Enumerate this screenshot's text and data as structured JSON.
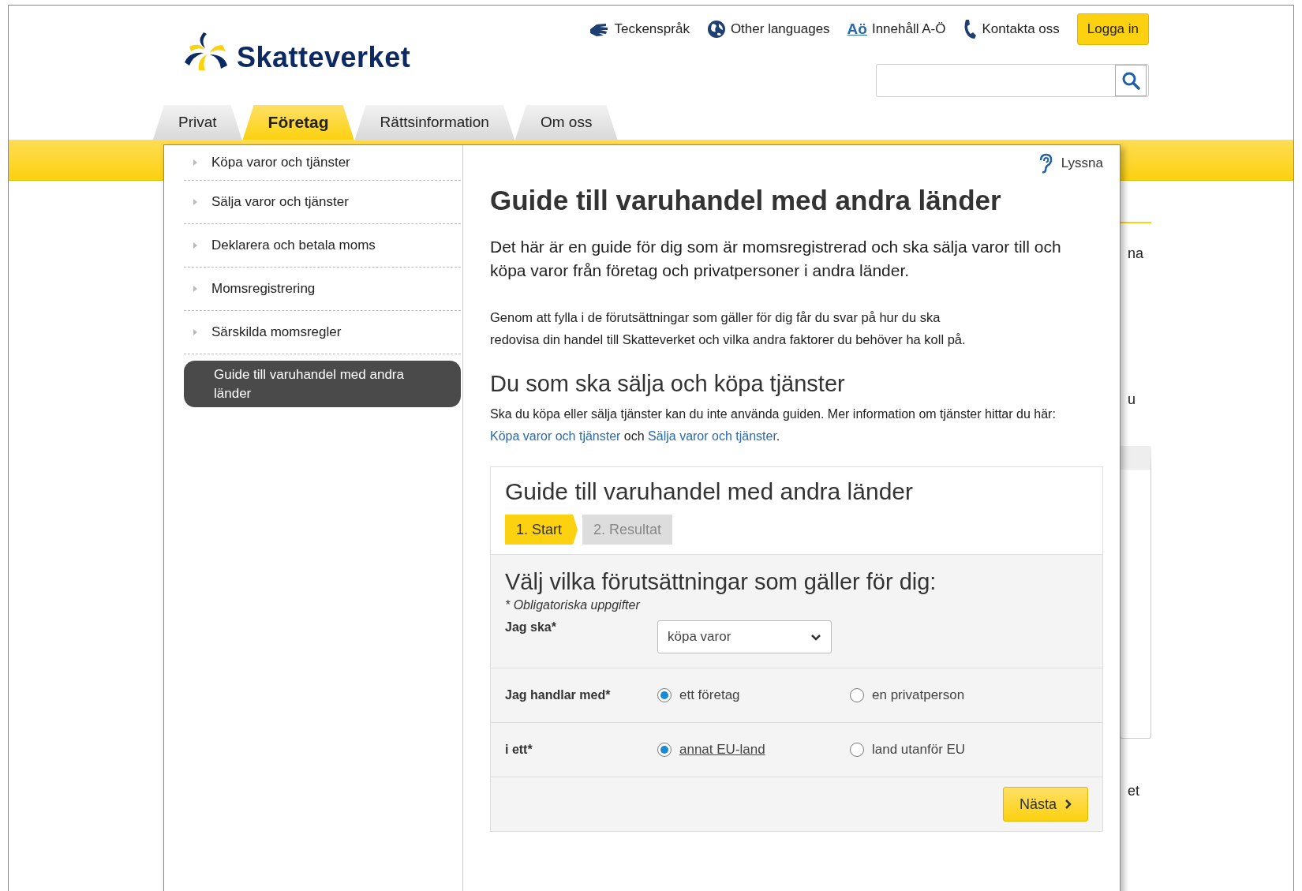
{
  "header": {
    "logo": "Skatteverket",
    "links": [
      {
        "kind": "sign",
        "label": "Teckenspråk"
      },
      {
        "kind": "globe",
        "label": "Other languages"
      },
      {
        "kind": "az",
        "icon_text": "Aö",
        "label": "Innehåll A-Ö"
      },
      {
        "kind": "phone",
        "label": "Kontakta oss"
      }
    ],
    "login": "Logga in"
  },
  "tabs": [
    {
      "label": "Privat",
      "selected": false
    },
    {
      "label": "Företag",
      "selected": true
    },
    {
      "label": "Rättsinformation",
      "selected": false
    },
    {
      "label": "Om oss",
      "selected": false
    }
  ],
  "background_fragments": [
    "na",
    "u",
    "et"
  ],
  "nav": {
    "items": [
      {
        "label": "Köpa varor och tjänster",
        "selected": false
      },
      {
        "label": "Sälja varor och tjänster",
        "selected": false
      },
      {
        "label": "Deklarera och betala moms",
        "selected": false
      },
      {
        "label": "Momsregistrering",
        "selected": false
      },
      {
        "label": "Särskilda momsregler",
        "selected": false
      },
      {
        "label": "Guide till varuhandel med andra länder",
        "selected": true
      }
    ]
  },
  "article": {
    "listen": "Lyssna",
    "title": "Guide till varuhandel med andra länder",
    "lead": "Det här är en guide för dig som är momsregistrerad och ska sälja varor till och köpa varor från företag och privatpersoner i andra länder.",
    "body": "Genom att fylla i de förutsättningar som gäller för dig får du svar på hur du ska redovisa din handel till Skatteverket och vilka andra faktorer du behöver ha koll på.",
    "subheading": "Du som ska sälja och köpa tjänster",
    "services": {
      "before": "Ska du köpa eller sälja tjänster kan du inte använda guiden. Mer information om tjänster hittar du här: ",
      "link1": "Köpa varor och tjänster",
      "middle": " och ",
      "link2": "Sälja varor och tjänster",
      "after": "."
    }
  },
  "guide": {
    "title": "Guide till varuhandel med andra länder",
    "steps": [
      {
        "label": "1. Start",
        "selected": true
      },
      {
        "label": "2. Resultat",
        "selected": false
      }
    ],
    "heading": "Välj vilka förutsättningar som gäller för dig:",
    "required_note": "* Obligatoriska uppgifter",
    "fields": [
      {
        "kind": "select",
        "label": "Jag ska*",
        "value": "köpa varor"
      },
      {
        "kind": "radio",
        "label": "Jag handlar med*",
        "options": [
          {
            "label": "ett företag",
            "selected": true,
            "underlined": false
          },
          {
            "label": "en privatperson",
            "selected": false,
            "underlined": false
          }
        ]
      },
      {
        "kind": "radio",
        "label": "i ett*",
        "options": [
          {
            "label": "annat EU-land",
            "selected": true,
            "underlined": true
          },
          {
            "label": "land utanför EU",
            "selected": false,
            "underlined": false
          }
        ]
      }
    ],
    "next_button": "Nästa"
  }
}
